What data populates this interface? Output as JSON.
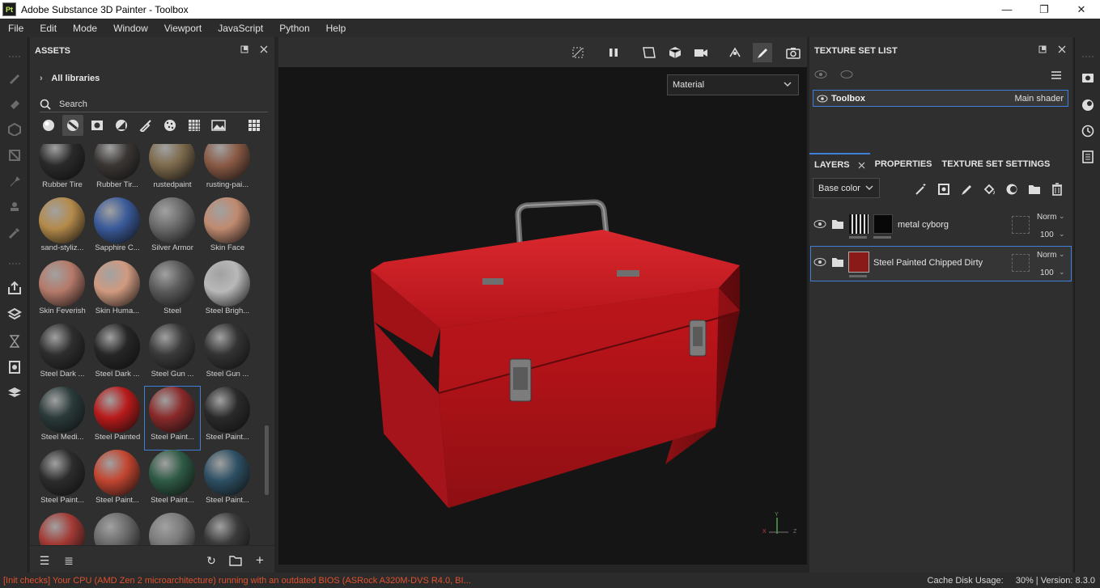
{
  "window": {
    "title": "Adobe Substance 3D Painter - Toolbox",
    "logo": "Pt",
    "minimize": "—",
    "maximize": "❐",
    "close": "✕"
  },
  "menu": [
    "File",
    "Edit",
    "Mode",
    "Window",
    "Viewport",
    "JavaScript",
    "Python",
    "Help"
  ],
  "assets": {
    "title": "ASSETS",
    "library": "All libraries",
    "search_placeholder": "Search",
    "items": [
      {
        "label": "Rubber Tire",
        "color": "#2a2a2a"
      },
      {
        "label": "Rubber Tir...",
        "color": "#3a3634"
      },
      {
        "label": "rustedpaint",
        "color": "#7d6a4c"
      },
      {
        "label": "rusting-pai...",
        "color": "#8a5a45"
      },
      {
        "label": "sand-styliz...",
        "color": "#b48a4a"
      },
      {
        "label": "Sapphire C...",
        "color": "#3a5a9a"
      },
      {
        "label": "Silver Armor",
        "color": "#6a6a6a"
      },
      {
        "label": "Skin Face",
        "color": "#c08a70"
      },
      {
        "label": "Skin Feverish",
        "color": "#b57a6a"
      },
      {
        "label": "Skin Huma...",
        "color": "#d09a80"
      },
      {
        "label": "Steel",
        "color": "#5a5a5a"
      },
      {
        "label": "Steel Brigh...",
        "color": "#b8b8b8"
      },
      {
        "label": "Steel Dark ...",
        "color": "#2e2e2e"
      },
      {
        "label": "Steel Dark ...",
        "color": "#262626"
      },
      {
        "label": "Steel Gun ...",
        "color": "#3a3a3a"
      },
      {
        "label": "Steel Gun ...",
        "color": "#333333"
      },
      {
        "label": "Steel Medi...",
        "color": "#2b3a3a"
      },
      {
        "label": "Steel Painted",
        "color": "#b81a1a"
      },
      {
        "label": "Steel Paint...",
        "color": "#8a2a2a"
      },
      {
        "label": "Steel Paint...",
        "color": "#2a2a2a"
      },
      {
        "label": "Steel Paint...",
        "color": "#2c2c2c"
      },
      {
        "label": "Steel Paint...",
        "color": "#c24530"
      },
      {
        "label": "Steel Paint...",
        "color": "#2e5a45"
      },
      {
        "label": "Steel Paint...",
        "color": "#2d4f63"
      },
      {
        "label": "",
        "color": "#a33a35"
      },
      {
        "label": "",
        "color": "#6a6a6a"
      },
      {
        "label": "",
        "color": "#7a7a7a"
      },
      {
        "label": "",
        "color": "#3a3a3a"
      }
    ]
  },
  "viewport": {
    "material_dropdown": "Material"
  },
  "texture_set_list": {
    "title": "TEXTURE SET LIST",
    "set_name": "Toolbox",
    "shader": "Main shader"
  },
  "layers_panel": {
    "tabs": [
      "LAYERS",
      "PROPERTIES",
      "TEXTURE SET SETTINGS"
    ],
    "channel": "Base color",
    "layers": [
      {
        "name": "metal cyborg",
        "blend": "Norm",
        "opacity": "100"
      },
      {
        "name": "Steel Painted Chipped Dirty",
        "blend": "Norm",
        "opacity": "100"
      }
    ]
  },
  "status": {
    "warning": "[Init checks] Your CPU (AMD Zen 2 microarchitecture) running with an outdated BIOS (ASRock A320M-DVS R4.0, BI...",
    "cache": "Cache Disk Usage:",
    "cache_value": "30% | Version: 8.3.0"
  },
  "colors": {
    "accent": "#3d7fd9",
    "warning": "#e0522e",
    "box_red": "#b3141a"
  }
}
